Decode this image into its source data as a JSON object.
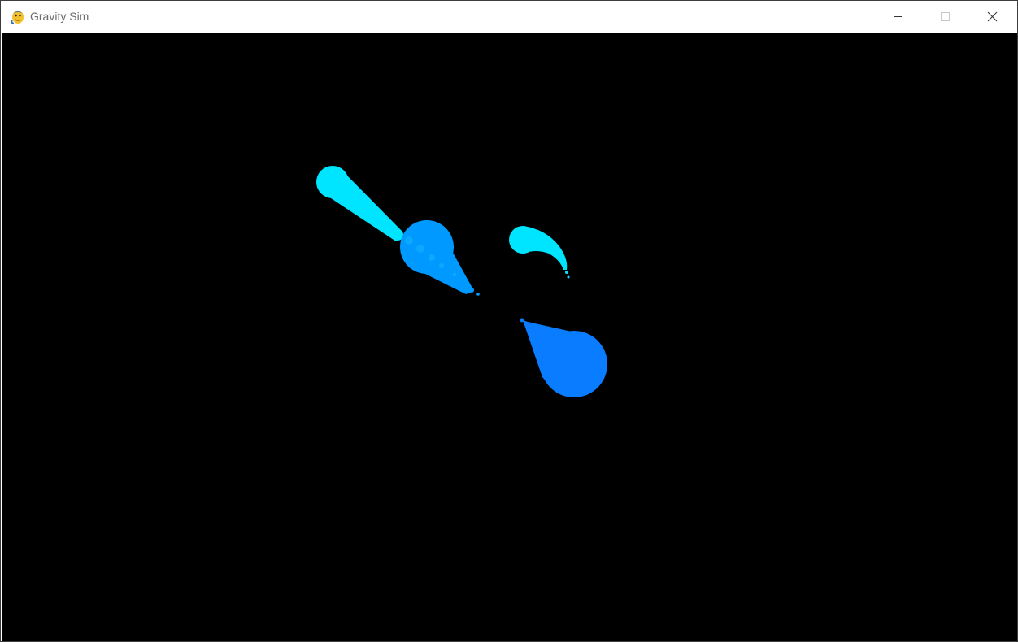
{
  "window": {
    "title": "Gravity Sim",
    "app_icon": "python-snake-icon",
    "controls": {
      "minimize": "minimize-icon",
      "maximize": "maximize-icon",
      "close": "close-icon"
    }
  },
  "canvas": {
    "background": "#000000",
    "colors": {
      "cyan": "#00e5ff",
      "sky": "#0099ff",
      "azure": "#0a7cff"
    }
  }
}
